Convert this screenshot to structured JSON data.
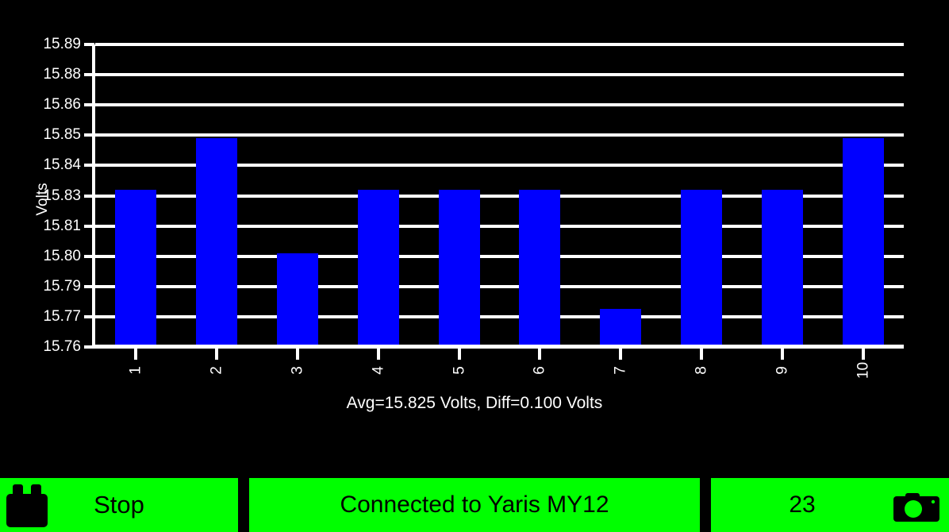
{
  "chart_data": {
    "type": "bar",
    "title": "",
    "subtitle": "",
    "xlabel": "",
    "ylabel": "Volts",
    "categories": [
      "1",
      "2",
      "3",
      "4",
      "5",
      "6",
      "7",
      "8",
      "9",
      "10"
    ],
    "values": [
      15.832,
      15.849,
      15.801,
      15.832,
      15.832,
      15.832,
      15.775,
      15.832,
      15.832,
      15.849
    ],
    "ylim": [
      15.76,
      15.89
    ],
    "ytick_labels": [
      "15.89",
      "15.88",
      "15.86",
      "15.85",
      "15.84",
      "15.83",
      "15.81",
      "15.80",
      "15.79",
      "15.77",
      "15.76"
    ],
    "ytick_values": [
      15.89,
      15.88,
      15.86,
      15.85,
      15.84,
      15.83,
      15.81,
      15.8,
      15.79,
      15.77,
      15.76
    ],
    "grid": true,
    "legend": "none",
    "bar_color": "#0000ff",
    "background_color": "#000000",
    "axis_color": "#ffffff",
    "annotation": "Avg=15.825 Volts, Diff=0.100 Volts"
  },
  "chart": {
    "caption": "Avg=15.825 Volts, Diff=0.100 Volts",
    "y_axis_title": "Volts"
  },
  "toolbar": {
    "stop_label": "Stop",
    "battery_icon": "battery-icon",
    "status_label": "Connected to Yaris MY12",
    "count_label": "23",
    "camera_icon": "camera-icon",
    "accent_color": "#00ff00",
    "text_color": "#000000"
  }
}
